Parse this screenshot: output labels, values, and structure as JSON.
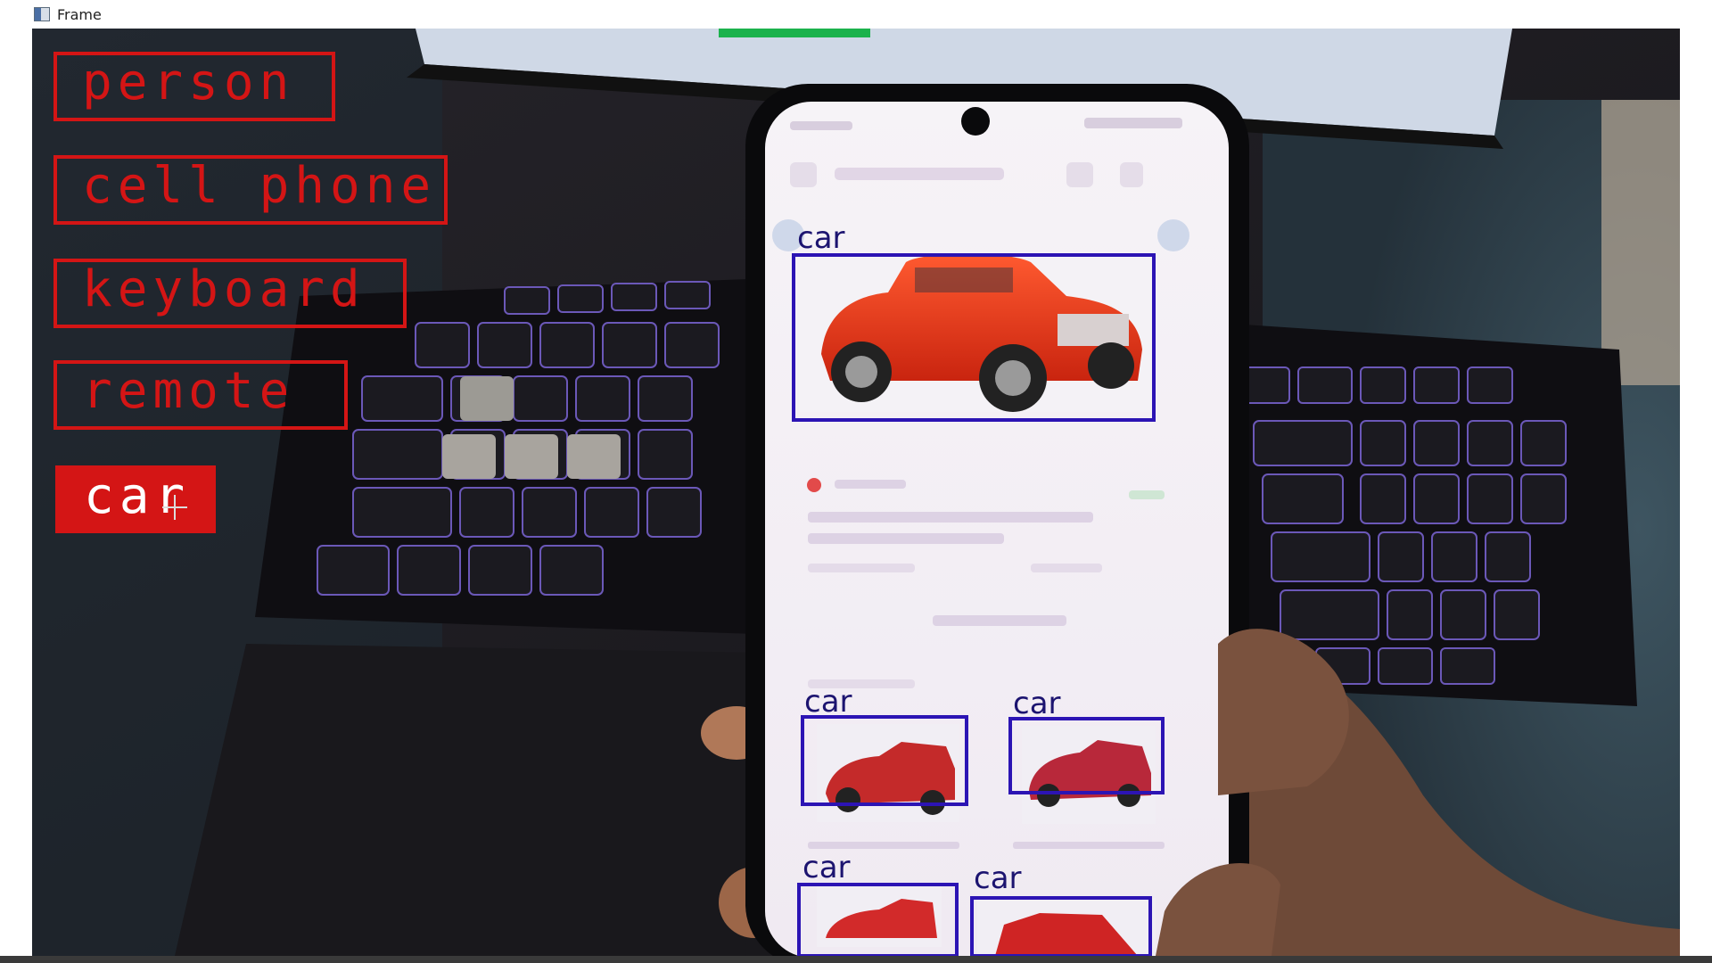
{
  "window": {
    "title": "Frame",
    "icon": "app-window-icon"
  },
  "class_buttons": [
    {
      "label": "person",
      "active": false
    },
    {
      "label": "cell phone",
      "active": false
    },
    {
      "label": "keyboard",
      "active": false
    },
    {
      "label": "remote",
      "active": false
    },
    {
      "label": "car",
      "active": true
    }
  ],
  "detections": [
    {
      "label": "car"
    },
    {
      "label": "car"
    },
    {
      "label": "car"
    },
    {
      "label": "car"
    },
    {
      "label": "car"
    }
  ],
  "colors": {
    "button_red": "#d41515",
    "box_blue": "#2c14b4",
    "box_label": "#1c1470"
  }
}
